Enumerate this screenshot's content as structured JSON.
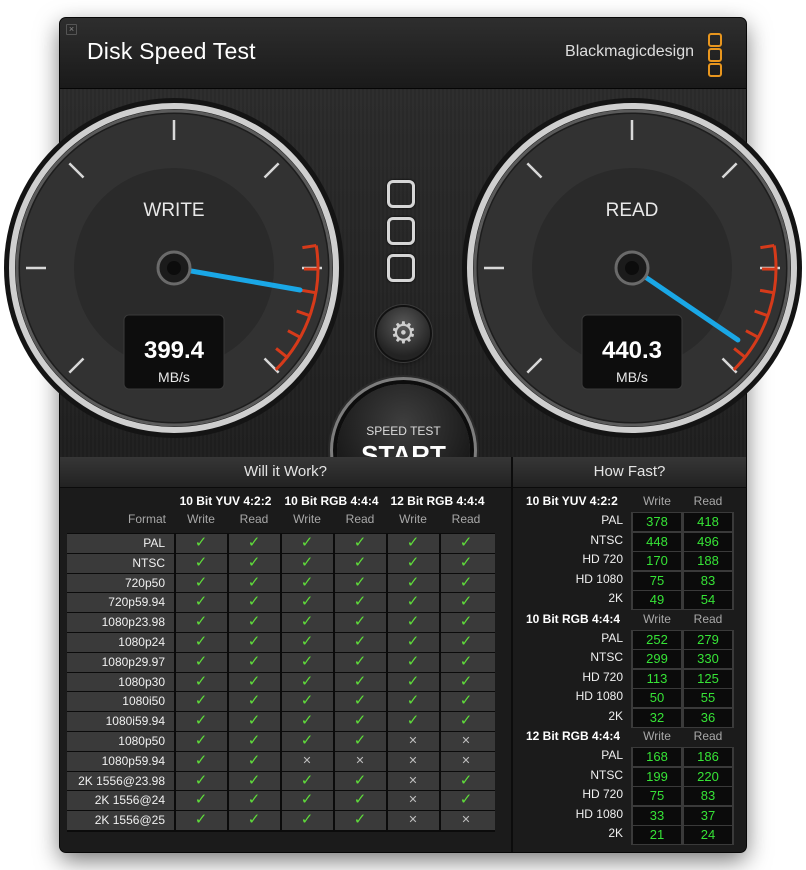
{
  "app": {
    "title": "Disk Speed Test",
    "brand": "Blackmagicdesign",
    "close_glyph": "×"
  },
  "gauges": {
    "write": {
      "label": "WRITE",
      "value": "399.4",
      "unit": "MB/s",
      "needle_fraction": 0.87
    },
    "read": {
      "label": "READ",
      "value": "440.3",
      "unit": "MB/s",
      "needle_fraction": 0.96
    }
  },
  "controls": {
    "gear_icon": "gear-icon",
    "gear_glyph": "⚙",
    "start_small": "SPEED TEST",
    "start_big": "START"
  },
  "colors": {
    "needle": "#1aa7e6",
    "check": "#5fdc3a",
    "value_green": "#36e336",
    "brand_orange": "#e8961e",
    "redline": "#d63a1a"
  },
  "will_it_work": {
    "heading": "Will it Work?",
    "format_label": "Format",
    "groups": [
      "10 Bit YUV 4:2:2",
      "10 Bit RGB 4:4:4",
      "12 Bit RGB 4:4:4"
    ],
    "sub_write": "Write",
    "sub_read": "Read",
    "rows": [
      {
        "format": "PAL",
        "cells": [
          1,
          1,
          1,
          1,
          1,
          1
        ]
      },
      {
        "format": "NTSC",
        "cells": [
          1,
          1,
          1,
          1,
          1,
          1
        ]
      },
      {
        "format": "720p50",
        "cells": [
          1,
          1,
          1,
          1,
          1,
          1
        ]
      },
      {
        "format": "720p59.94",
        "cells": [
          1,
          1,
          1,
          1,
          1,
          1
        ]
      },
      {
        "format": "1080p23.98",
        "cells": [
          1,
          1,
          1,
          1,
          1,
          1
        ]
      },
      {
        "format": "1080p24",
        "cells": [
          1,
          1,
          1,
          1,
          1,
          1
        ]
      },
      {
        "format": "1080p29.97",
        "cells": [
          1,
          1,
          1,
          1,
          1,
          1
        ]
      },
      {
        "format": "1080p30",
        "cells": [
          1,
          1,
          1,
          1,
          1,
          1
        ]
      },
      {
        "format": "1080i50",
        "cells": [
          1,
          1,
          1,
          1,
          1,
          1
        ]
      },
      {
        "format": "1080i59.94",
        "cells": [
          1,
          1,
          1,
          1,
          1,
          1
        ]
      },
      {
        "format": "1080p50",
        "cells": [
          1,
          1,
          1,
          1,
          0,
          0
        ]
      },
      {
        "format": "1080p59.94",
        "cells": [
          1,
          1,
          0,
          0,
          0,
          0
        ]
      },
      {
        "format": "2K 1556@23.98",
        "cells": [
          1,
          1,
          1,
          1,
          0,
          1
        ]
      },
      {
        "format": "2K 1556@24",
        "cells": [
          1,
          1,
          1,
          1,
          0,
          1
        ]
      },
      {
        "format": "2K 1556@25",
        "cells": [
          1,
          1,
          1,
          1,
          0,
          0
        ]
      }
    ]
  },
  "how_fast": {
    "heading": "How Fast?",
    "sub_write": "Write",
    "sub_read": "Read",
    "groups": [
      {
        "name": "10 Bit YUV 4:2:2",
        "rows": [
          {
            "format": "PAL",
            "write": "378",
            "read": "418"
          },
          {
            "format": "NTSC",
            "write": "448",
            "read": "496"
          },
          {
            "format": "HD 720",
            "write": "170",
            "read": "188"
          },
          {
            "format": "HD 1080",
            "write": "75",
            "read": "83"
          },
          {
            "format": "2K",
            "write": "49",
            "read": "54"
          }
        ]
      },
      {
        "name": "10 Bit RGB 4:4:4",
        "rows": [
          {
            "format": "PAL",
            "write": "252",
            "read": "279"
          },
          {
            "format": "NTSC",
            "write": "299",
            "read": "330"
          },
          {
            "format": "HD 720",
            "write": "113",
            "read": "125"
          },
          {
            "format": "HD 1080",
            "write": "50",
            "read": "55"
          },
          {
            "format": "2K",
            "write": "32",
            "read": "36"
          }
        ]
      },
      {
        "name": "12 Bit RGB 4:4:4",
        "rows": [
          {
            "format": "PAL",
            "write": "168",
            "read": "186"
          },
          {
            "format": "NTSC",
            "write": "199",
            "read": "220"
          },
          {
            "format": "HD 720",
            "write": "75",
            "read": "83"
          },
          {
            "format": "HD 1080",
            "write": "33",
            "read": "37"
          },
          {
            "format": "2K",
            "write": "21",
            "read": "24"
          }
        ]
      }
    ]
  }
}
